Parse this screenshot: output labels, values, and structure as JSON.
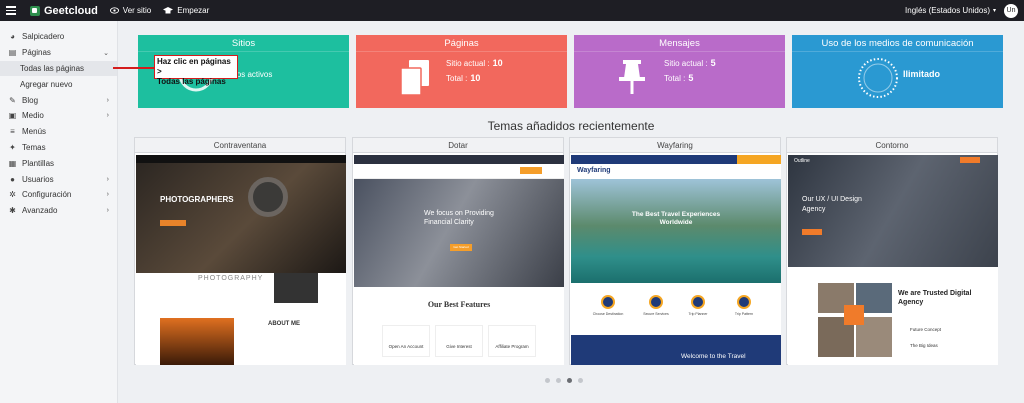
{
  "topbar": {
    "brand": "Geetcloud",
    "links": [
      {
        "label": "Ver sitio",
        "icon": "eye-icon"
      },
      {
        "label": "Empezar",
        "icon": "graduation-cap-icon"
      }
    ],
    "language": "Inglés (Estados Unidos)",
    "avatar": "Un"
  },
  "sidebar": {
    "items": [
      {
        "label": "Salpicadero",
        "icon": "palette-icon"
      },
      {
        "label": "Páginas",
        "icon": "pages-icon",
        "expanded": true
      },
      {
        "label": "Blog",
        "icon": "pin-icon"
      },
      {
        "label": "Medio",
        "icon": "media-icon"
      },
      {
        "label": "Menús",
        "icon": "list-icon"
      },
      {
        "label": "Temas",
        "icon": "palette-icon"
      },
      {
        "label": "Plantillas",
        "icon": "template-icon"
      },
      {
        "label": "Usuarios",
        "icon": "users-icon"
      },
      {
        "label": "Configuración",
        "icon": "gear-icon"
      },
      {
        "label": "Avanzado",
        "icon": "gear-icon"
      }
    ],
    "sub_items": [
      "Todas las páginas",
      "Agregar nuevo"
    ]
  },
  "callout": {
    "line1": "Haz clic en páginas >",
    "line2": "Todas las páginas"
  },
  "cards": {
    "sitios": {
      "title": "Sitios",
      "text": "itios activos",
      "color": "#1abc9c"
    },
    "paginas": {
      "title": "Páginas",
      "current_label": "Sitio actual :",
      "current_value": "10",
      "total_label": "Total :",
      "total_value": "10",
      "color": "#f0675c"
    },
    "mensajes": {
      "title": "Mensajes",
      "current_label": "Sitio actual :",
      "current_value": "5",
      "total_label": "Total :",
      "total_value": "5",
      "color": "#b565c7"
    },
    "medios": {
      "title": "Uso de los medios de comunicación",
      "value": "Ilimitado",
      "color": "#2896cf"
    }
  },
  "themes": {
    "title": "Temas añadidos recientemente",
    "items": [
      {
        "name": "Contraventana",
        "hero": "PHOTOGRAPHERS",
        "strip": "PHOTOGRAPHY",
        "about": "ABOUT ME"
      },
      {
        "name": "Dotar",
        "hero": "We focus on Providing Financial Clarity",
        "features": "Our Best Features",
        "f1": "Open An Account",
        "f2": "Give Interest",
        "f3": "Affiliate Program",
        "btn": "Get Started"
      },
      {
        "name": "Wayfaring",
        "logo": "Wayfaring",
        "hero": "The Best Travel Experiences Worldwide",
        "footer": "Welcome to the Travel",
        "icons": [
          "Choose Destination",
          "Secure Services",
          "Trip Planner",
          "Trip Pattern"
        ]
      },
      {
        "name": "Contorno",
        "logo": "Outline",
        "hero": "Our UX / UI Design Agency",
        "heading": "We are Trusted Digital Agency",
        "l1": "Future Concept",
        "l2": "The Big Ideas"
      }
    ],
    "pagination": 4,
    "active_page": 3
  }
}
